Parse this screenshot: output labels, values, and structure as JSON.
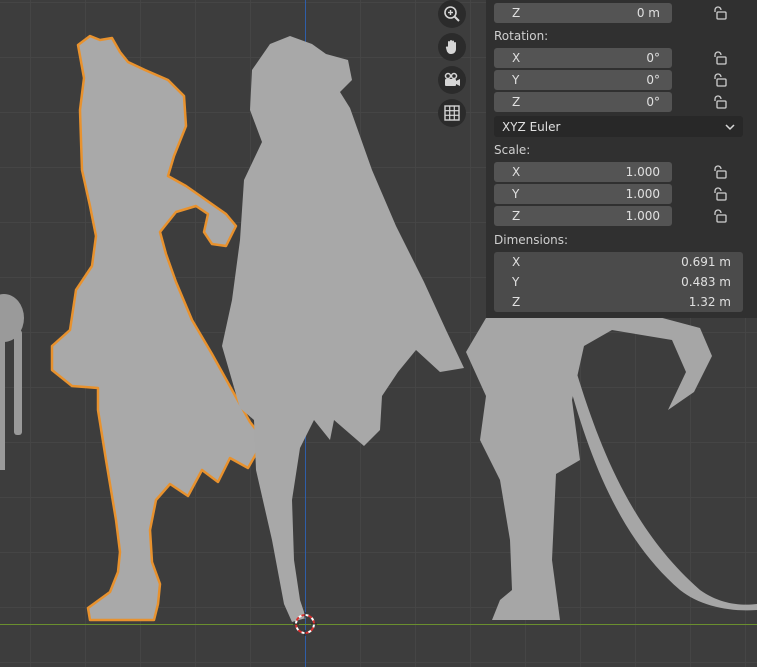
{
  "viewport": {
    "nav_icons": [
      "zoom-icon",
      "hand-pan-icon",
      "camera-icon",
      "grid-icon"
    ]
  },
  "transform": {
    "location_z": {
      "axis": "Z",
      "value": "0 m"
    },
    "rotation_label": "Rotation:",
    "rotation": [
      {
        "axis": "X",
        "value": "0°"
      },
      {
        "axis": "Y",
        "value": "0°"
      },
      {
        "axis": "Z",
        "value": "0°"
      }
    ],
    "rotation_mode": "XYZ Euler",
    "scale_label": "Scale:",
    "scale": [
      {
        "axis": "X",
        "value": "1.000"
      },
      {
        "axis": "Y",
        "value": "1.000"
      },
      {
        "axis": "Z",
        "value": "1.000"
      }
    ],
    "dimensions_label": "Dimensions:",
    "dimensions": [
      {
        "axis": "X",
        "value": "0.691 m"
      },
      {
        "axis": "Y",
        "value": "0.483 m"
      },
      {
        "axis": "Z",
        "value": "1.32 m"
      }
    ]
  },
  "colors": {
    "selection_outline": "#e8922e",
    "panel_bg": "#303030",
    "field_bg": "#545454",
    "model_gray": "#a8a8a8"
  }
}
